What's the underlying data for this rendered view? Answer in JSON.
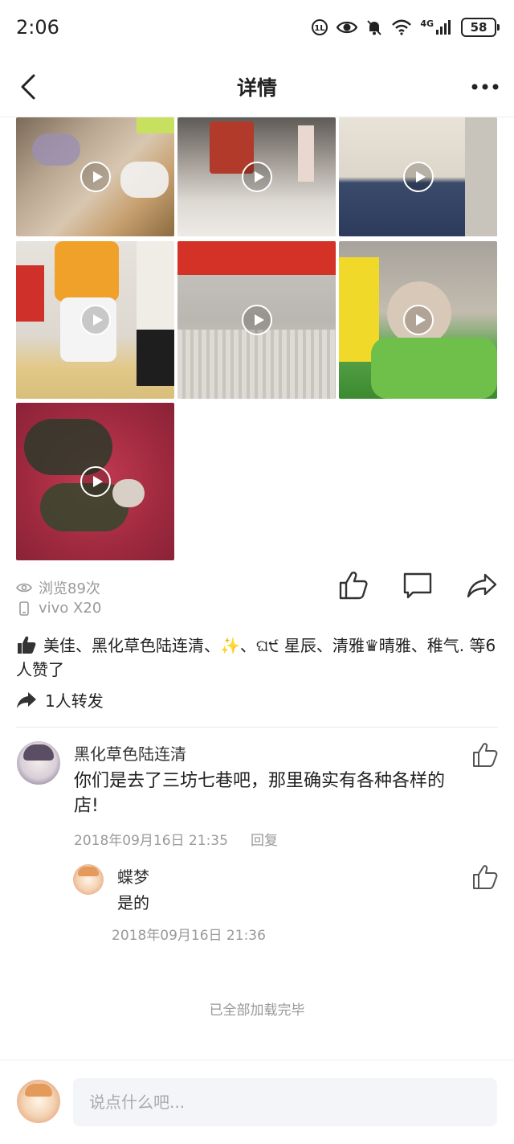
{
  "status_bar": {
    "time": "2:06",
    "network_label": "4G",
    "battery": "58",
    "icons": [
      "hd-icon",
      "eye-icon",
      "mute-bell-icon",
      "wifi-icon",
      "signal-icon",
      "battery-icon"
    ]
  },
  "nav": {
    "title": "详情",
    "back_icon": "chevron-left-icon",
    "more_icon": "more-dots-icon"
  },
  "media": [
    {
      "type": "video",
      "desc": "plush toys store"
    },
    {
      "type": "video",
      "desc": "mall train"
    },
    {
      "type": "video",
      "desc": "person walking"
    },
    {
      "type": "video",
      "desc": "mascot costume"
    },
    {
      "type": "video",
      "desc": "hamster in box"
    },
    {
      "type": "video",
      "desc": "hamster eating vegetable"
    },
    {
      "type": "video",
      "desc": "hamster bowl"
    }
  ],
  "post_meta": {
    "views": "浏览89次",
    "device": "vivo X20"
  },
  "likes": {
    "text": "美佳、黑化草色陆连清、✨、ଘ੯ 星辰、清雅♛晴雅、稚气. 等6人赞了"
  },
  "forward": {
    "text": "1人转发"
  },
  "comments": [
    {
      "name": "黑化草色陆连清",
      "text": "你们是去了三坊七巷吧，那里确实有各种各样的店!",
      "time": "2018年09月16日 21:35",
      "reply_label": "回复",
      "replies": [
        {
          "name": "蝶梦",
          "text": "是的",
          "time": "2018年09月16日 21:36"
        }
      ]
    }
  ],
  "footer": {
    "loaded_text": "已全部加载完毕"
  },
  "input": {
    "placeholder": "说点什么吧..."
  }
}
